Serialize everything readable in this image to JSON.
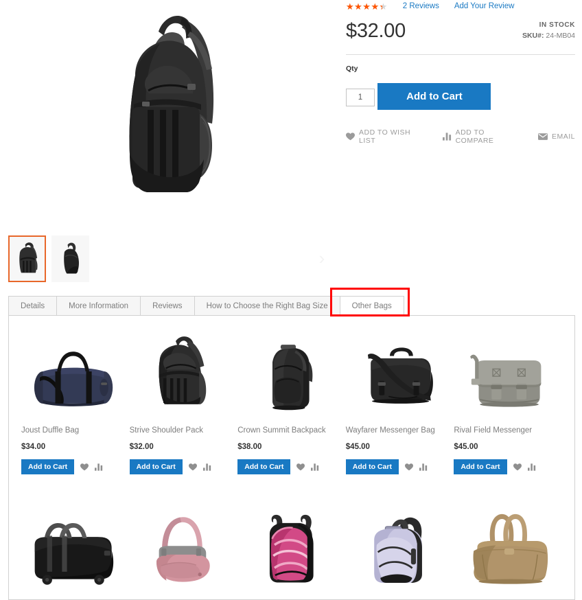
{
  "product": {
    "rating_stars": "★★★★★",
    "rating_percent": 88,
    "reviews_link": "2 Reviews",
    "add_review_link": "Add Your Review",
    "price": "$32.00",
    "stock_status": "IN STOCK",
    "sku_label": "SKU#:",
    "sku_value": "24-MB04",
    "qty_label": "Qty",
    "qty_value": "1",
    "add_to_cart_label": "Add to Cart",
    "actions": [
      {
        "label": "ADD TO WISH LIST",
        "icon": "heart-icon"
      },
      {
        "label": "ADD TO COMPARE",
        "icon": "compare-icon"
      },
      {
        "label": "EMAIL",
        "icon": "envelope-icon"
      }
    ]
  },
  "gallery": {
    "next_arrow": "›",
    "thumbs": [
      {
        "name": "strive-shoulder-pack-front",
        "selected": true
      },
      {
        "name": "strive-shoulder-pack-side",
        "selected": false
      }
    ]
  },
  "tabs": [
    {
      "label": "Details",
      "active": false
    },
    {
      "label": "More Information",
      "active": false
    },
    {
      "label": "Reviews",
      "active": false
    },
    {
      "label": "How to Choose the Right Bag Size",
      "active": false
    },
    {
      "label": "Other Bags",
      "active": true
    }
  ],
  "highlight_color": "#ff0000",
  "accent_color": "#1979c3",
  "star_color": "#ff5501",
  "related_products": {
    "row1": [
      {
        "name": "Joust Duffle Bag",
        "price": "$34.00",
        "cart_label": "Add to Cart",
        "image": "navy-duffle"
      },
      {
        "name": "Strive Shoulder Pack",
        "price": "$32.00",
        "cart_label": "Add to Cart",
        "image": "black-sling"
      },
      {
        "name": "Crown Summit Backpack",
        "price": "$38.00",
        "cart_label": "Add to Cart",
        "image": "black-backpack"
      },
      {
        "name": "Wayfarer Messenger Bag",
        "price": "$45.00",
        "cart_label": "Add to Cart",
        "image": "black-messenger"
      },
      {
        "name": "Rival Field Messenger",
        "price": "$45.00",
        "cart_label": "Add to Cart",
        "image": "gray-messenger"
      }
    ],
    "row2": [
      {
        "image": "black-rolling-duffle"
      },
      {
        "image": "pink-hobo"
      },
      {
        "image": "pink-black-backpack"
      },
      {
        "image": "lavender-backpack"
      },
      {
        "image": "tan-tote"
      }
    ]
  }
}
